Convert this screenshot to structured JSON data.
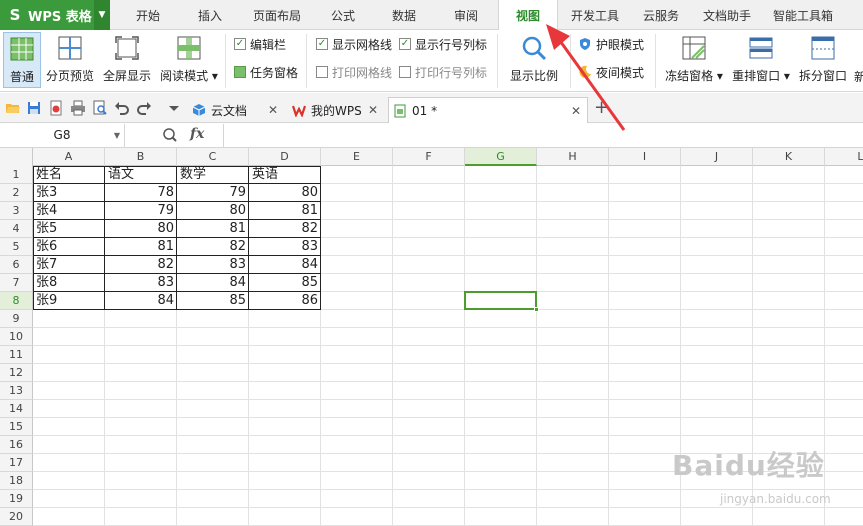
{
  "app": {
    "name": "WPS 表格",
    "logo": "S"
  },
  "menu_tabs": [
    "开始",
    "插入",
    "页面布局",
    "公式",
    "数据",
    "审阅",
    "视图",
    "开发工具",
    "云服务",
    "文档助手",
    "智能工具箱"
  ],
  "active_tab": "视图",
  "ribbon": {
    "normal": "普通",
    "page_break_preview": "分页预览",
    "full_screen": "全屏显示",
    "reading_mode": "阅读模式",
    "edit_bar": "编辑栏",
    "task_pane": "任务窗格",
    "show_gridlines": "显示网格线",
    "print_gridlines": "打印网格线",
    "show_headers": "显示行号列标",
    "print_headers": "打印行号列标",
    "zoom": "显示比例",
    "eye_protection": "护眼模式",
    "night_mode": "夜间模式",
    "freeze_panes": "冻结窗格",
    "arrange": "重排窗口",
    "split": "拆分窗口",
    "new_window_partial": "新"
  },
  "doc_tabs": [
    {
      "label": "云文档"
    },
    {
      "label": "我的WPS"
    },
    {
      "label": "01 *"
    }
  ],
  "formula_bar": {
    "name_box": "G8",
    "fx": "fx",
    "content": ""
  },
  "columns": [
    "A",
    "B",
    "C",
    "D",
    "E",
    "F",
    "G",
    "H",
    "I",
    "J",
    "K",
    "L"
  ],
  "selected_column": "G",
  "rows": [
    "1",
    "2",
    "3",
    "4",
    "5",
    "6",
    "7",
    "8",
    "9",
    "10",
    "11",
    "12",
    "13",
    "14",
    "15",
    "16",
    "17",
    "18",
    "19",
    "20"
  ],
  "selected_row": "8",
  "table": {
    "headers": [
      "姓名",
      "语文",
      "数学",
      "英语"
    ],
    "rows": [
      [
        "张3",
        "78",
        "79",
        "80"
      ],
      [
        "张4",
        "79",
        "80",
        "81"
      ],
      [
        "张5",
        "80",
        "81",
        "82"
      ],
      [
        "张6",
        "81",
        "82",
        "83"
      ],
      [
        "张7",
        "82",
        "83",
        "84"
      ],
      [
        "张8",
        "83",
        "84",
        "85"
      ],
      [
        "张9",
        "84",
        "85",
        "86"
      ]
    ]
  },
  "watermark": {
    "brand": "Baidu经验",
    "url": "jingyan.baidu.com"
  },
  "colors": {
    "accent": "#3b9a3b",
    "arrow": "#e8373a",
    "selection": "#4d9c2d"
  }
}
